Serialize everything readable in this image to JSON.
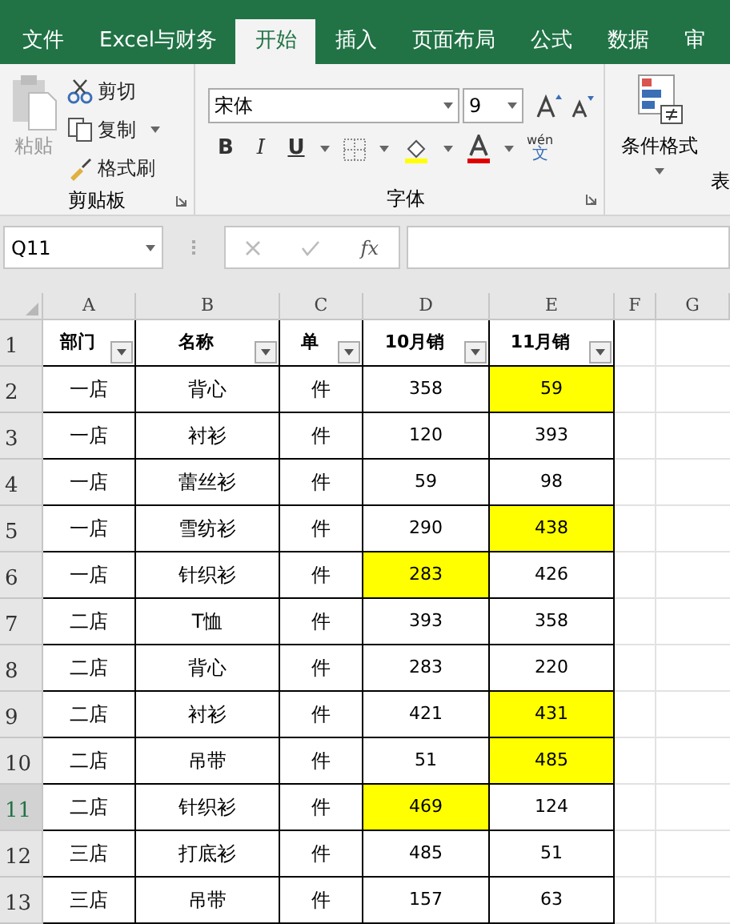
{
  "tabs": [
    {
      "label": "文件",
      "selected": false
    },
    {
      "label": "Excel与财务",
      "selected": false
    },
    {
      "label": "开始",
      "selected": true
    },
    {
      "label": "插入",
      "selected": false
    },
    {
      "label": "页面布局",
      "selected": false
    },
    {
      "label": "公式",
      "selected": false
    },
    {
      "label": "数据",
      "selected": false
    },
    {
      "label": "审",
      "selected": false
    }
  ],
  "clipboard": {
    "paste": {
      "label": "粘贴",
      "disabled": true
    },
    "cut": "剪切",
    "copy": "复制",
    "format_painter": "格式刷",
    "group_label": "剪贴板"
  },
  "font": {
    "name": "宋体",
    "size": "9",
    "group_label": "字体",
    "bold": "B",
    "italic": "I",
    "underline": "U",
    "phonetic_top": "wén",
    "phonetic_bottom": "文"
  },
  "styles": {
    "conditional_format": "条件格式",
    "table_format": "表"
  },
  "name_box": "Q11",
  "fx": "fx",
  "columns": [
    "A",
    "B",
    "C",
    "D",
    "E",
    "F",
    "G"
  ],
  "header_row": {
    "number": "1",
    "selected": false,
    "cells": [
      "部门",
      "名称",
      "单",
      "10月销",
      "11月销"
    ]
  },
  "rows": [
    {
      "number": "2",
      "selected": false,
      "cells": [
        "一店",
        "背心",
        "件"
      ],
      "sales": [
        {
          "text": "358",
          "highlighted": false
        },
        {
          "text": "59",
          "highlighted": true
        }
      ]
    },
    {
      "number": "3",
      "selected": false,
      "cells": [
        "一店",
        "衬衫",
        "件"
      ],
      "sales": [
        {
          "text": "120",
          "highlighted": false
        },
        {
          "text": "393",
          "highlighted": false
        }
      ]
    },
    {
      "number": "4",
      "selected": false,
      "cells": [
        "一店",
        "蕾丝衫",
        "件"
      ],
      "sales": [
        {
          "text": "59",
          "highlighted": false
        },
        {
          "text": "98",
          "highlighted": false
        }
      ]
    },
    {
      "number": "5",
      "selected": false,
      "cells": [
        "一店",
        "雪纺衫",
        "件"
      ],
      "sales": [
        {
          "text": "290",
          "highlighted": false
        },
        {
          "text": "438",
          "highlighted": true
        }
      ]
    },
    {
      "number": "6",
      "selected": false,
      "cells": [
        "一店",
        "针织衫",
        "件"
      ],
      "sales": [
        {
          "text": "283",
          "highlighted": true
        },
        {
          "text": "426",
          "highlighted": false
        }
      ]
    },
    {
      "number": "7",
      "selected": false,
      "cells": [
        "二店",
        "T恤",
        "件"
      ],
      "sales": [
        {
          "text": "393",
          "highlighted": false
        },
        {
          "text": "358",
          "highlighted": false
        }
      ]
    },
    {
      "number": "8",
      "selected": false,
      "cells": [
        "二店",
        "背心",
        "件"
      ],
      "sales": [
        {
          "text": "283",
          "highlighted": false
        },
        {
          "text": "220",
          "highlighted": false
        }
      ]
    },
    {
      "number": "9",
      "selected": false,
      "cells": [
        "二店",
        "衬衫",
        "件"
      ],
      "sales": [
        {
          "text": "421",
          "highlighted": false
        },
        {
          "text": "431",
          "highlighted": true
        }
      ]
    },
    {
      "number": "10",
      "selected": false,
      "cells": [
        "二店",
        "吊带",
        "件"
      ],
      "sales": [
        {
          "text": "51",
          "highlighted": false
        },
        {
          "text": "485",
          "highlighted": true
        }
      ]
    },
    {
      "number": "11",
      "selected": true,
      "cells": [
        "二店",
        "针织衫",
        "件"
      ],
      "sales": [
        {
          "text": "469",
          "highlighted": true
        },
        {
          "text": "124",
          "highlighted": false
        }
      ]
    },
    {
      "number": "12",
      "selected": false,
      "cells": [
        "三店",
        "打底衫",
        "件"
      ],
      "sales": [
        {
          "text": "485",
          "highlighted": false
        },
        {
          "text": "51",
          "highlighted": false
        }
      ]
    },
    {
      "number": "13",
      "selected": false,
      "cells": [
        "三店",
        "吊带",
        "件"
      ],
      "sales": [
        {
          "text": "157",
          "highlighted": false
        },
        {
          "text": "63",
          "highlighted": false
        }
      ]
    }
  ]
}
